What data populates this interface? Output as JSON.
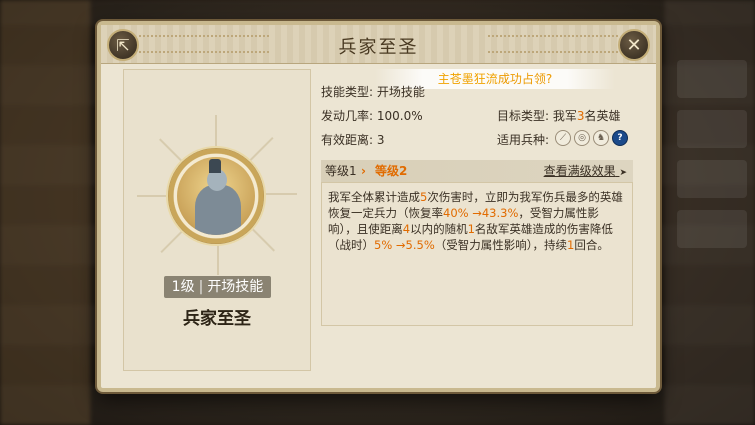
{
  "window": {
    "title": "兵家至圣"
  },
  "banner": {
    "highlight": "主苍墨狂流",
    "text": "成功占领",
    "suffix": "?"
  },
  "skill": {
    "level_label": "1级",
    "type_label": "开场技能",
    "name": "兵家至圣"
  },
  "info": {
    "type_label": "技能类型:",
    "type_value": "开场技能",
    "rate_label": "发动几率:",
    "rate_value": "100.0%",
    "target_label": "目标类型:",
    "target_pre": "我军",
    "target_num": "3",
    "target_post": "名英雄",
    "range_label": "有效距离:",
    "range_value": "3",
    "troop_label": "适用兵种:"
  },
  "troop_icons": [
    "spear-icon",
    "shield-icon",
    "horse-icon",
    "question-icon"
  ],
  "level": {
    "from": "等级1",
    "arrow": "›",
    "to": "等级2",
    "max_link": "查看满级效果",
    "max_arrow": "➤"
  },
  "description": {
    "p1": "我军全体累计造成",
    "n1": "5",
    "p2": "次伤害时，立即为我军伤兵最多的英雄恢复一定兵力（恢复率",
    "n2": "40% →43.3%",
    "p3": "，受智力属性影响），且使距离",
    "n3": "4",
    "p4": "以内的随机",
    "n4": "1",
    "p5": "名敌军英雄造成的伤害降低（战时）",
    "n5": "5% →5.5%",
    "p6": "（受智力属性影响），持续",
    "n6": "1",
    "p7": "回合。"
  },
  "colors": {
    "accent": "#e16b00",
    "panel": "#ece5d3",
    "border": "#c9b98f"
  }
}
